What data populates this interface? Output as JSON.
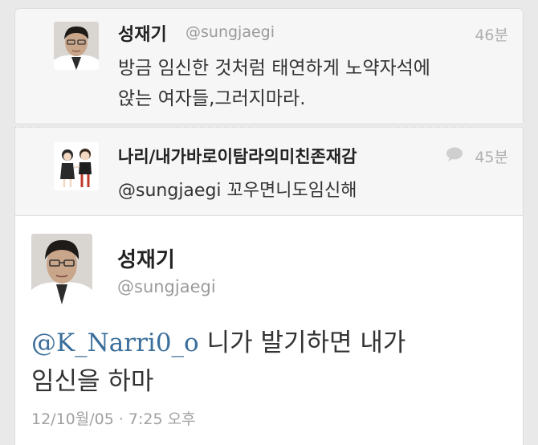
{
  "tweet_1": {
    "name": "성재기",
    "handle": "@sungjaegi",
    "time": "46분",
    "line1": "방금 임신한 것처럼 태연하게 노약자석에",
    "line2": "앉는 여자들,그러지마라."
  },
  "tweet_2": {
    "name": "나리/내가바로이탐라의미친존재감",
    "time": "45분",
    "text": "@sungjaegi 꼬우면니도임신해",
    "reply_icon": "speech-bubble-icon"
  },
  "main_tweet": {
    "name": "성재기",
    "handle": "@sungjaegi",
    "mention": "@K_Narri0_o",
    "line1_rest": " 니가 발기하면 내가",
    "line2": "임신을 하마",
    "timestamp": "12/10월/05 · 7:25 오후"
  }
}
